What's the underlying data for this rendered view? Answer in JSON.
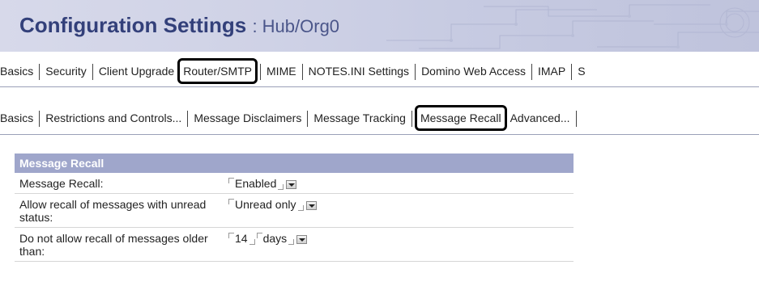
{
  "header": {
    "title": "Configuration Settings",
    "subtitle": ": Hub/Org0"
  },
  "main_tabs": [
    "Basics",
    "Security",
    "Client Upgrade",
    "Router/SMTP",
    "MIME",
    "NOTES.INI Settings",
    "Domino Web Access",
    "IMAP",
    "S"
  ],
  "main_tabs_selected": "Router/SMTP",
  "sub_tabs": [
    "Basics",
    "Restrictions and Controls...",
    "Message Disclaimers",
    "Message Tracking",
    "Message Recall",
    "Advanced..."
  ],
  "sub_tabs_selected": "Message Recall",
  "section": {
    "title": "Message Recall",
    "rows": [
      {
        "label": "Message Recall:",
        "value": "Enabled"
      },
      {
        "label": "Allow recall of messages with unread status:",
        "value": "Unread only"
      },
      {
        "label": "Do not allow recall of messages older than:",
        "value": "14",
        "unit": "days"
      }
    ]
  },
  "colors": {
    "title_text": "#33407a",
    "section_header_bg": "#9fa6cb",
    "selected_border": "#000000"
  },
  "icons": [
    "dropdown-arrow-icon"
  ]
}
